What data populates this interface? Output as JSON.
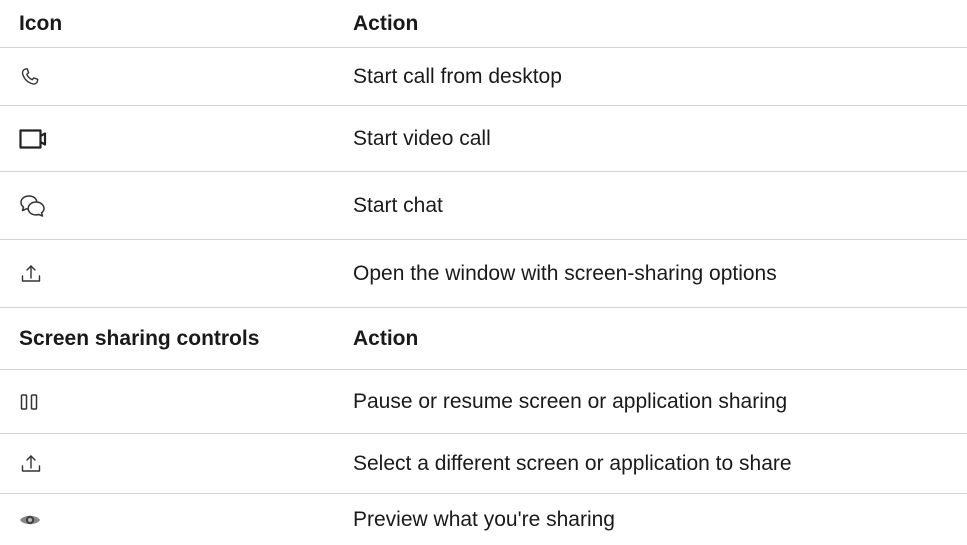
{
  "section1": {
    "header": {
      "icon_col": "Icon",
      "action_col": "Action"
    },
    "rows": [
      {
        "icon": "phone-icon",
        "action": "Start call from desktop"
      },
      {
        "icon": "video-camera-icon",
        "action": "Start video call"
      },
      {
        "icon": "chat-bubbles-icon",
        "action": "Start chat"
      },
      {
        "icon": "share-upload-icon",
        "action": "Open the window with screen-sharing options"
      }
    ]
  },
  "section2": {
    "header": {
      "icon_col": "Screen sharing controls",
      "action_col": "Action"
    },
    "rows": [
      {
        "icon": "pause-icon",
        "action": "Pause or resume screen or application sharing"
      },
      {
        "icon": "share-upload-icon",
        "action": "Select a different screen or application to share"
      },
      {
        "icon": "eye-icon",
        "action": "Preview what you're sharing"
      }
    ]
  },
  "colors": {
    "text": "#1a1a1a",
    "icon": "#333333",
    "divider": "#d2d2d2"
  }
}
